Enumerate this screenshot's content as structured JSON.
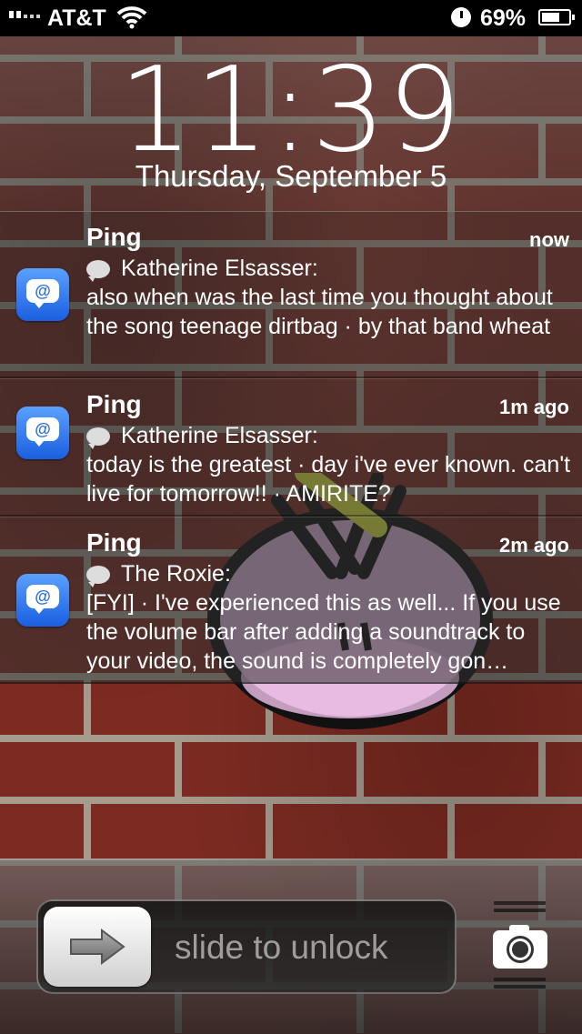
{
  "status_bar": {
    "carrier": "AT&T",
    "battery_percent": "69%",
    "battery_level": 0.69
  },
  "lock": {
    "time": "11:39",
    "date": "Thursday, September 5"
  },
  "notifications": [
    {
      "app": "Ping",
      "time": "now",
      "sender": "Katherine Elsasser:",
      "body": "also when was the last time you thought about the song teenage dirtbag · by that band wheat"
    },
    {
      "app": "Ping",
      "time": "1m ago",
      "sender": "Katherine Elsasser:",
      "body": "today is the greatest · day i've ever known. can't live for tomorrow!! · AMIRITE?"
    },
    {
      "app": "Ping",
      "time": "2m ago",
      "sender": "The Roxie:",
      "body": "[FYI] · I've experienced this as well... If you use the volume bar after adding a soundtrack to your video, the sound is completely gon…"
    }
  ],
  "unlock": {
    "slider_label": "slide to unlock"
  },
  "icons": {
    "app_icon": "ping-at-bubble-icon",
    "sender_icon": "speech-bubble-icon",
    "camera": "camera-icon",
    "arrow": "arrow-right-icon"
  }
}
